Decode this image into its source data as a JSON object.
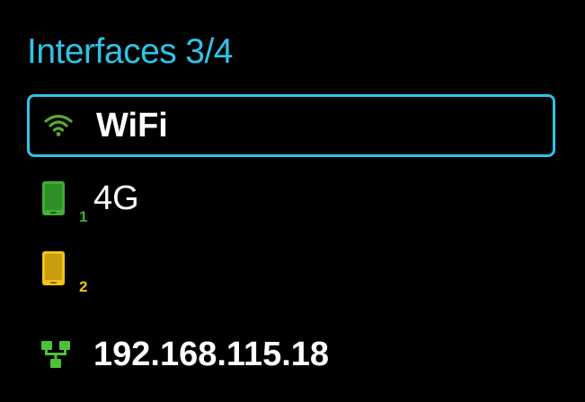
{
  "header": {
    "title": "Interfaces",
    "counter": "3/4"
  },
  "colors": {
    "accent": "#2ec3e6",
    "wifi": "#5aa832",
    "sim1": "#3fae35",
    "sim2": "#f2c21b",
    "ethernet": "#4fc136",
    "background": "#000000",
    "text": "#ffffff"
  },
  "interfaces": [
    {
      "icon": "wifi-icon",
      "label": "WiFi",
      "selected": true
    },
    {
      "icon": "mobile-sim1-icon",
      "sim_index": "1",
      "label": "4G",
      "selected": false
    },
    {
      "icon": "mobile-sim2-icon",
      "sim_index": "2",
      "label": "",
      "selected": false
    },
    {
      "icon": "ethernet-icon",
      "label": "192.168.115.18",
      "selected": false
    }
  ]
}
